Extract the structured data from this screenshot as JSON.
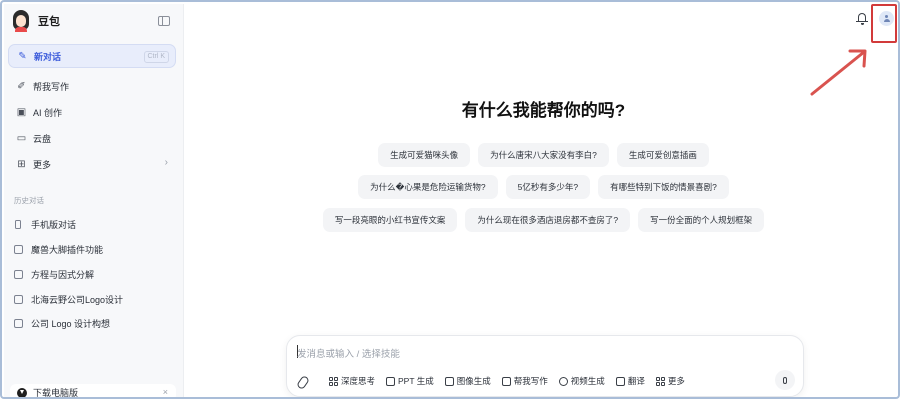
{
  "app": {
    "name": "豆包"
  },
  "sidebar": {
    "nav": [
      {
        "label": "新对话",
        "icon": "new-chat-icon",
        "shortcut": "Ctrl K",
        "active": true
      },
      {
        "label": "帮我写作",
        "icon": "writing-icon"
      },
      {
        "label": "AI 创作",
        "icon": "image-create-icon"
      },
      {
        "label": "云盘",
        "icon": "cloud-drive-icon"
      },
      {
        "label": "更多",
        "icon": "more-grid-icon"
      }
    ],
    "history_label": "历史对话",
    "history": [
      {
        "label": "手机版对话",
        "icon": "phone-icon"
      },
      {
        "label": "魔兽大脚插件功能",
        "icon": "chat-icon"
      },
      {
        "label": "方程与因式分解",
        "icon": "chat-icon"
      },
      {
        "label": "北海云野公司Logo设计",
        "icon": "chat-icon"
      },
      {
        "label": "公司 Logo 设计构想",
        "icon": "chat-icon"
      }
    ],
    "download": {
      "label": "下载电脑版",
      "close": "×"
    }
  },
  "main": {
    "headline": "有什么我能帮你的吗?",
    "suggestions": [
      [
        "生成可爱猫咪头像",
        "为什么唐宋八大家没有李白?",
        "生成可爱创意插画"
      ],
      [
        "为什么�心果是危险运输货物?",
        "5亿秒有多少年?",
        "有哪些特别下饭的情景喜剧?"
      ],
      [
        "写一段亮眼的小红书宣传文案",
        "为什么现在很多酒店退房都不查房了?",
        "写一份全面的个人规划框架"
      ]
    ]
  },
  "composer": {
    "placeholder": "发消息或输入 / 选择技能",
    "tools": [
      {
        "label": "深度思考",
        "icon": "deep-think-icon"
      },
      {
        "label": "PPT 生成",
        "icon": "ppt-icon"
      },
      {
        "label": "图像生成",
        "icon": "image-icon"
      },
      {
        "label": "帮我写作",
        "icon": "write-icon"
      },
      {
        "label": "视频生成",
        "icon": "video-icon"
      },
      {
        "label": "翻译",
        "icon": "translate-icon"
      },
      {
        "label": "更多",
        "icon": "more-icon"
      }
    ]
  },
  "colors": {
    "accent": "#3b5bdb",
    "annotation": "#d23a3a"
  }
}
